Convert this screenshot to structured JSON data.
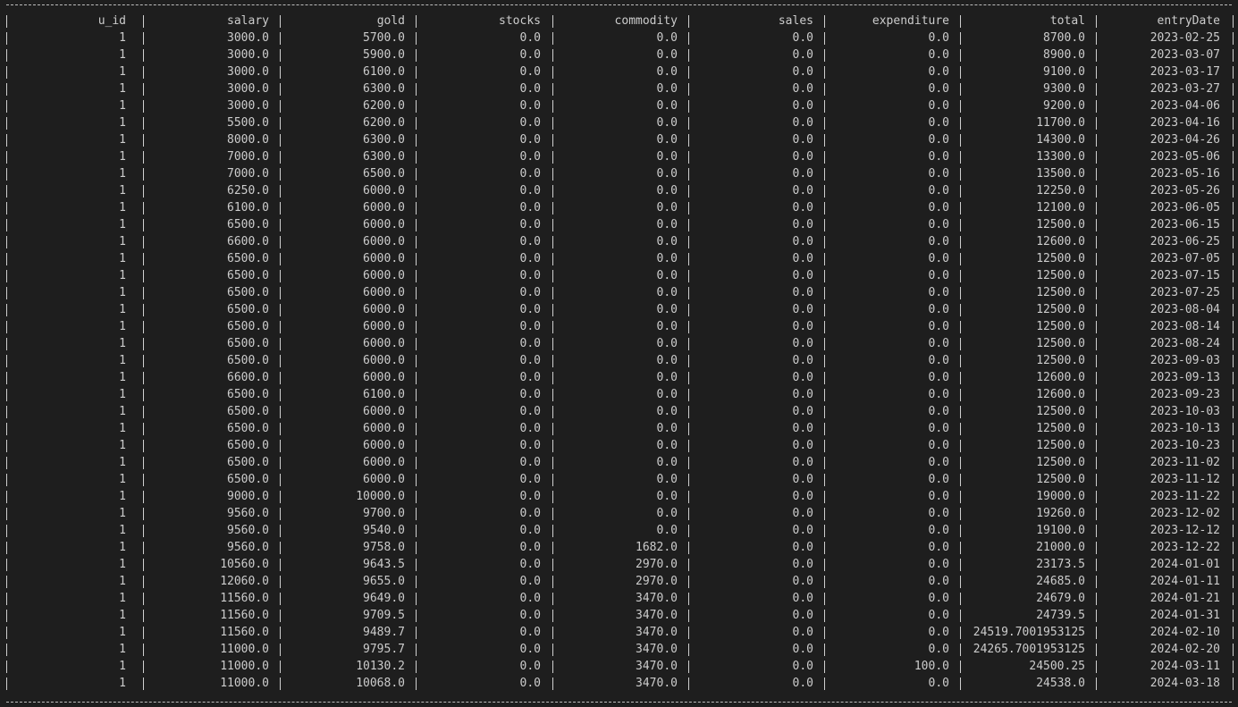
{
  "table": {
    "columns": [
      "u_id",
      "salary",
      "gold",
      "stocks",
      "commodity",
      "sales",
      "expenditure",
      "total",
      "entryDate"
    ],
    "rows": [
      [
        "1",
        "3000.0",
        "5700.0",
        "0.0",
        "0.0",
        "0.0",
        "0.0",
        "8700.0",
        "2023-02-25"
      ],
      [
        "1",
        "3000.0",
        "5900.0",
        "0.0",
        "0.0",
        "0.0",
        "0.0",
        "8900.0",
        "2023-03-07"
      ],
      [
        "1",
        "3000.0",
        "6100.0",
        "0.0",
        "0.0",
        "0.0",
        "0.0",
        "9100.0",
        "2023-03-17"
      ],
      [
        "1",
        "3000.0",
        "6300.0",
        "0.0",
        "0.0",
        "0.0",
        "0.0",
        "9300.0",
        "2023-03-27"
      ],
      [
        "1",
        "3000.0",
        "6200.0",
        "0.0",
        "0.0",
        "0.0",
        "0.0",
        "9200.0",
        "2023-04-06"
      ],
      [
        "1",
        "5500.0",
        "6200.0",
        "0.0",
        "0.0",
        "0.0",
        "0.0",
        "11700.0",
        "2023-04-16"
      ],
      [
        "1",
        "8000.0",
        "6300.0",
        "0.0",
        "0.0",
        "0.0",
        "0.0",
        "14300.0",
        "2023-04-26"
      ],
      [
        "1",
        "7000.0",
        "6300.0",
        "0.0",
        "0.0",
        "0.0",
        "0.0",
        "13300.0",
        "2023-05-06"
      ],
      [
        "1",
        "7000.0",
        "6500.0",
        "0.0",
        "0.0",
        "0.0",
        "0.0",
        "13500.0",
        "2023-05-16"
      ],
      [
        "1",
        "6250.0",
        "6000.0",
        "0.0",
        "0.0",
        "0.0",
        "0.0",
        "12250.0",
        "2023-05-26"
      ],
      [
        "1",
        "6100.0",
        "6000.0",
        "0.0",
        "0.0",
        "0.0",
        "0.0",
        "12100.0",
        "2023-06-05"
      ],
      [
        "1",
        "6500.0",
        "6000.0",
        "0.0",
        "0.0",
        "0.0",
        "0.0",
        "12500.0",
        "2023-06-15"
      ],
      [
        "1",
        "6600.0",
        "6000.0",
        "0.0",
        "0.0",
        "0.0",
        "0.0",
        "12600.0",
        "2023-06-25"
      ],
      [
        "1",
        "6500.0",
        "6000.0",
        "0.0",
        "0.0",
        "0.0",
        "0.0",
        "12500.0",
        "2023-07-05"
      ],
      [
        "1",
        "6500.0",
        "6000.0",
        "0.0",
        "0.0",
        "0.0",
        "0.0",
        "12500.0",
        "2023-07-15"
      ],
      [
        "1",
        "6500.0",
        "6000.0",
        "0.0",
        "0.0",
        "0.0",
        "0.0",
        "12500.0",
        "2023-07-25"
      ],
      [
        "1",
        "6500.0",
        "6000.0",
        "0.0",
        "0.0",
        "0.0",
        "0.0",
        "12500.0",
        "2023-08-04"
      ],
      [
        "1",
        "6500.0",
        "6000.0",
        "0.0",
        "0.0",
        "0.0",
        "0.0",
        "12500.0",
        "2023-08-14"
      ],
      [
        "1",
        "6500.0",
        "6000.0",
        "0.0",
        "0.0",
        "0.0",
        "0.0",
        "12500.0",
        "2023-08-24"
      ],
      [
        "1",
        "6500.0",
        "6000.0",
        "0.0",
        "0.0",
        "0.0",
        "0.0",
        "12500.0",
        "2023-09-03"
      ],
      [
        "1",
        "6600.0",
        "6000.0",
        "0.0",
        "0.0",
        "0.0",
        "0.0",
        "12600.0",
        "2023-09-13"
      ],
      [
        "1",
        "6500.0",
        "6100.0",
        "0.0",
        "0.0",
        "0.0",
        "0.0",
        "12600.0",
        "2023-09-23"
      ],
      [
        "1",
        "6500.0",
        "6000.0",
        "0.0",
        "0.0",
        "0.0",
        "0.0",
        "12500.0",
        "2023-10-03"
      ],
      [
        "1",
        "6500.0",
        "6000.0",
        "0.0",
        "0.0",
        "0.0",
        "0.0",
        "12500.0",
        "2023-10-13"
      ],
      [
        "1",
        "6500.0",
        "6000.0",
        "0.0",
        "0.0",
        "0.0",
        "0.0",
        "12500.0",
        "2023-10-23"
      ],
      [
        "1",
        "6500.0",
        "6000.0",
        "0.0",
        "0.0",
        "0.0",
        "0.0",
        "12500.0",
        "2023-11-02"
      ],
      [
        "1",
        "6500.0",
        "6000.0",
        "0.0",
        "0.0",
        "0.0",
        "0.0",
        "12500.0",
        "2023-11-12"
      ],
      [
        "1",
        "9000.0",
        "10000.0",
        "0.0",
        "0.0",
        "0.0",
        "0.0",
        "19000.0",
        "2023-11-22"
      ],
      [
        "1",
        "9560.0",
        "9700.0",
        "0.0",
        "0.0",
        "0.0",
        "0.0",
        "19260.0",
        "2023-12-02"
      ],
      [
        "1",
        "9560.0",
        "9540.0",
        "0.0",
        "0.0",
        "0.0",
        "0.0",
        "19100.0",
        "2023-12-12"
      ],
      [
        "1",
        "9560.0",
        "9758.0",
        "0.0",
        "1682.0",
        "0.0",
        "0.0",
        "21000.0",
        "2023-12-22"
      ],
      [
        "1",
        "10560.0",
        "9643.5",
        "0.0",
        "2970.0",
        "0.0",
        "0.0",
        "23173.5",
        "2024-01-01"
      ],
      [
        "1",
        "12060.0",
        "9655.0",
        "0.0",
        "2970.0",
        "0.0",
        "0.0",
        "24685.0",
        "2024-01-11"
      ],
      [
        "1",
        "11560.0",
        "9649.0",
        "0.0",
        "3470.0",
        "0.0",
        "0.0",
        "24679.0",
        "2024-01-21"
      ],
      [
        "1",
        "11560.0",
        "9709.5",
        "0.0",
        "3470.0",
        "0.0",
        "0.0",
        "24739.5",
        "2024-01-31"
      ],
      [
        "1",
        "11560.0",
        "9489.7",
        "0.0",
        "3470.0",
        "0.0",
        "0.0",
        "24519.7001953125",
        "2024-02-10"
      ],
      [
        "1",
        "11000.0",
        "9795.7",
        "0.0",
        "3470.0",
        "0.0",
        "0.0",
        "24265.7001953125",
        "2024-02-20"
      ],
      [
        "1",
        "11000.0",
        "10130.2",
        "0.0",
        "3470.0",
        "0.0",
        "100.0",
        "24500.25",
        "2024-03-11"
      ],
      [
        "1",
        "11000.0",
        "10068.0",
        "0.0",
        "3470.0",
        "0.0",
        "0.0",
        "24538.0",
        "2024-03-18"
      ]
    ]
  }
}
